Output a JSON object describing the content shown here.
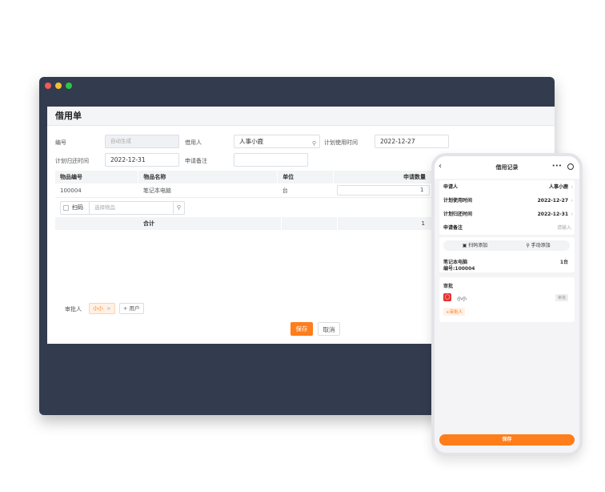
{
  "window": {
    "traffic_colors": [
      "#ee5c58",
      "#f4be2f",
      "#28c840"
    ]
  },
  "form": {
    "title": "借用单",
    "number_label": "编号",
    "number_placeholder": "自动生成",
    "borrower_label": "借用人",
    "borrower_value": "人事小鹿",
    "plan_use_label": "计划使用时间",
    "plan_use_value": "2022-12-27",
    "plan_return_label": "计划归还时间",
    "plan_return_value": "2022-12-31",
    "remark_label": "申请备注",
    "table": {
      "headers": [
        "物品编号",
        "物品名称",
        "单位",
        "申请数量"
      ],
      "rows": [
        {
          "code": "100004",
          "name": "笔记本电脑",
          "unit": "台",
          "qty": "1"
        }
      ],
      "scan_label": "扫码",
      "select_placeholder": "选择物品",
      "total_label": "合计",
      "total_value": "1"
    },
    "approver_label": "审批人",
    "approver_tag": "小小",
    "add_user_label": "用户",
    "save_label": "保存",
    "cancel_label": "取消"
  },
  "phone": {
    "title": "借用记录",
    "applicant_label": "申请人",
    "applicant_value": "人事小鹿",
    "plan_use_label": "计划使用时间",
    "plan_use_value": "2022-12-27",
    "plan_return_label": "计划归还时间",
    "plan_return_value": "2022-12-31",
    "remark_label": "申请备注",
    "remark_placeholder": "请输入",
    "scan_add_label": "扫码添加",
    "manual_add_label": "手动添加",
    "item_name": "笔记本电脑",
    "item_qty": "1台",
    "item_code": "编号:100004",
    "approval_label": "审批",
    "approver_name": "小小",
    "approver_status": "审批",
    "add_approver_label": "+审批人",
    "save_label": "保存"
  },
  "colors": {
    "accent": "#ff7d1a",
    "window_bg": "#333b4f"
  }
}
